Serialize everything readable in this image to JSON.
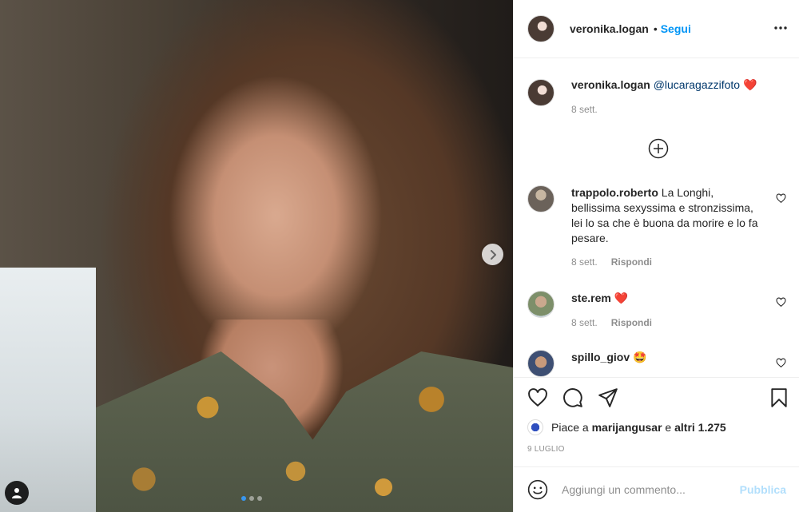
{
  "post": {
    "author": "veronika.logan",
    "follow_label": "Segui",
    "header_separator": "•",
    "carousel": {
      "slides": 3,
      "active_slide": 1
    }
  },
  "caption": {
    "author": "veronika.logan",
    "mention": "@lucaragazzifoto",
    "emoji": "❤️",
    "time": "8 sett."
  },
  "comments": [
    {
      "user": "trappolo.roberto",
      "text": "La Longhi, bellissima sexyssima e stronzissima, lei lo sa che è buona da morire e lo fa pesare.",
      "time": "8 sett.",
      "reply_label": "Rispondi"
    },
    {
      "user": "ste.rem",
      "text": "❤️",
      "time": "8 sett.",
      "reply_label": "Rispondi"
    },
    {
      "user": "spillo_giov",
      "text": "🤩",
      "time": "",
      "reply_label": ""
    }
  ],
  "likes": {
    "prefix": "Piace a",
    "user": "marijangusar",
    "middle": "e",
    "others": "altri 1.275"
  },
  "post_date": "9 luglio",
  "add_comment": {
    "placeholder": "Aggiungi un commento...",
    "publish_label": "Pubblica"
  },
  "colors": {
    "accent": "#0095f6",
    "publish_disabled": "#b2dffc",
    "heart_red": "#ed4956",
    "carousel_dot_active": "#3897f0"
  },
  "icons": [
    "chevron-right-icon",
    "user-tag-icon",
    "more-icon",
    "plus-circle-icon",
    "heart-icon",
    "comment-icon",
    "share-icon",
    "bookmark-icon",
    "emoji-icon"
  ]
}
